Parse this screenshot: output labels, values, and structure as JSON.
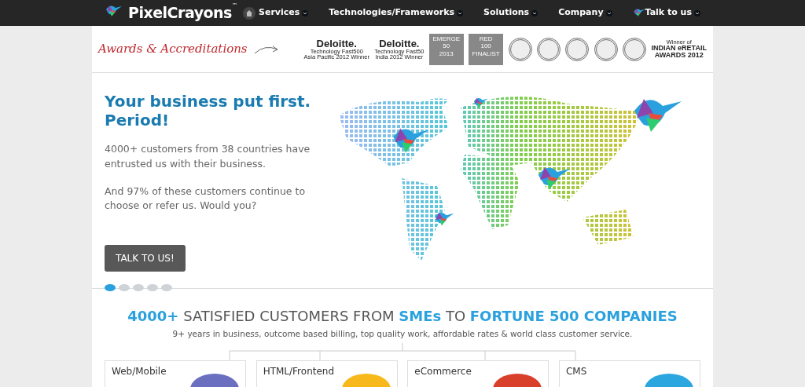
{
  "header": {
    "logo": "PixelCrayons",
    "logo_mark": "™",
    "nav": [
      {
        "label": "Services"
      },
      {
        "label": "Technologies/Frameworks"
      },
      {
        "label": "Solutions"
      },
      {
        "label": "Company"
      },
      {
        "label": "Talk to us",
        "kind": "bird"
      }
    ]
  },
  "awards": {
    "title": "Awards & Accreditations",
    "items": [
      {
        "kind": "deloitte",
        "name": "Deloitte.",
        "line1": "Technology Fast500",
        "line2": "Asia Pacific 2012 Winner"
      },
      {
        "kind": "deloitte",
        "name": "Deloitte.",
        "line1": "Technology Fast50",
        "line2": "India 2012 Winner"
      },
      {
        "kind": "square",
        "name": "EMERGE",
        "line1": "50",
        "line2": "2013"
      },
      {
        "kind": "square",
        "name": "RED",
        "line1": "100",
        "line2": "FINALIST"
      },
      {
        "kind": "seal"
      },
      {
        "kind": "seal"
      },
      {
        "kind": "seal"
      },
      {
        "kind": "seal"
      },
      {
        "kind": "seal"
      },
      {
        "kind": "text",
        "name": "Winner of",
        "line1": "INDIAN eRETAIL",
        "line2": "AWARDS 2012"
      }
    ]
  },
  "hero": {
    "title": "Your business put first. Period!",
    "paragraphs": [
      "4000+ customers from 38 countries have entrusted us with their business.",
      "And 97% of these customers continue to choose or refer us. Would you?"
    ],
    "button": "TALK TO US!",
    "slides": [
      {
        "selected": true
      },
      {
        "selected": false
      },
      {
        "selected": false
      },
      {
        "selected": false
      },
      {
        "selected": false
      }
    ]
  },
  "customers": {
    "headline": "**4000+** SATISFIED CUSTOMERS FROM **SMEs** TO **FORTUNE 500 COMPANIES**",
    "subtitle": "9+ years in business, outcome based billing, top quality work, affordable rates & world class customer service.",
    "cards": [
      {
        "label": "Web/Mobile",
        "color": "#6b6fc0"
      },
      {
        "label": "HTML/Frontend",
        "color": "#f6b81a"
      },
      {
        "label": "eCommerce",
        "color": "#d9402b"
      },
      {
        "label": "CMS",
        "color": "#2ba6de"
      }
    ]
  }
}
